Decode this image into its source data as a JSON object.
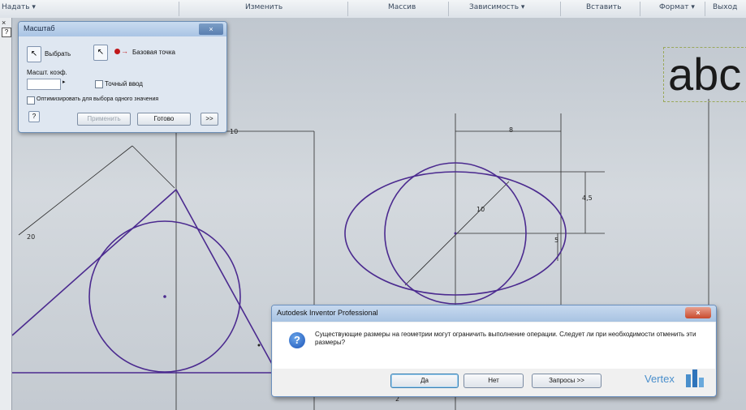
{
  "ribbon": {
    "panels": [
      "Надать ▾",
      "Изменить",
      "Массив",
      "Зависимость ▾",
      "Вставить",
      "Формат ▾",
      "Выход"
    ]
  },
  "left_stub": {
    "close": "×",
    "help": "?"
  },
  "canvas": {
    "big_text": "abc",
    "dimensions": [
      "10",
      "20",
      "8",
      "10",
      "4,5",
      "5",
      "2"
    ]
  },
  "scale_dialog": {
    "title": "Масштаб",
    "close": "×",
    "select_label": "Выбрать",
    "base_point_label": "Базовая точка",
    "scale_factor_label": "Масшт. коэф.",
    "scale_factor_value": "",
    "precise_input_label": "Точный ввод",
    "optimize_label": "Оптимизировать для выбора одного значения",
    "help_icon": "?",
    "apply_label": "Применить",
    "done_label": "Готово",
    "expand_label": ">>"
  },
  "message_box": {
    "title": "Autodesk Inventor Professional",
    "close": "×",
    "text": "Существующие размеры на геометрии могут ограничить выполнение операции. Следует ли при необходимости отменить эти размеры?",
    "yes_label": "Да",
    "no_label": "Нет",
    "more_label": "Запросы >>"
  },
  "watermark": {
    "text": "Vertex"
  },
  "colors": {
    "sketch": "#4b2a8f",
    "dialog_title": "#a9c4e4",
    "close_red": "#c84a2e"
  }
}
